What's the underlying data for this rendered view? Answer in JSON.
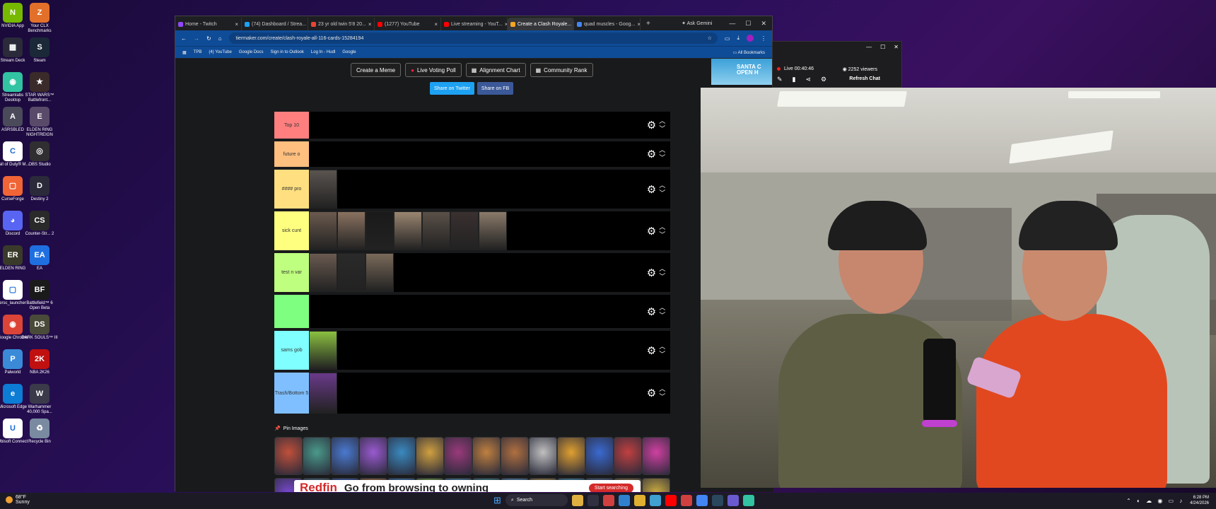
{
  "desktop": {
    "icons": [
      {
        "label": "NVIDIA App",
        "color": "#76b900",
        "glyph": "N"
      },
      {
        "label": "Your CLX Benchmarks",
        "color": "#e2702a",
        "glyph": "Z"
      },
      {
        "label": "Stream Deck",
        "color": "#2a2a3a",
        "glyph": "▦"
      },
      {
        "label": "Steam",
        "color": "#1b2838",
        "glyph": "S"
      },
      {
        "label": "Streamlabs Desktop",
        "color": "#31c3a2",
        "glyph": "◉"
      },
      {
        "label": "STAR WARS™ Battlefront...",
        "color": "#3a2a2a",
        "glyph": "★"
      },
      {
        "label": "ASRSBLED",
        "color": "#4a4a5a",
        "glyph": "A"
      },
      {
        "label": "ELDEN RING NIGHTREIGN",
        "color": "#5a4a6a",
        "glyph": "E"
      },
      {
        "label": "Call of Duty® M...",
        "color": "#ffffff",
        "glyph": "C"
      },
      {
        "label": "OBS Studio",
        "color": "#302e31",
        "glyph": "◎"
      },
      {
        "label": "CurseForge",
        "color": "#f16436",
        "glyph": "▢"
      },
      {
        "label": "Destiny 2",
        "color": "#2a2a3a",
        "glyph": "D"
      },
      {
        "label": "Discord",
        "color": "#5865f2",
        "glyph": "◕"
      },
      {
        "label": "Counter-Str... 2",
        "color": "#2a2a2a",
        "glyph": "CS"
      },
      {
        "label": "ELDEN RING",
        "color": "#3a3a2a",
        "glyph": "ER"
      },
      {
        "label": "EA",
        "color": "#1f6fe0",
        "glyph": "EA"
      },
      {
        "label": "ersc_launcher",
        "color": "#ffffff",
        "glyph": "▢"
      },
      {
        "label": "Battlefield™ 6 Open Beta",
        "color": "#1a1a1a",
        "glyph": "BF"
      },
      {
        "label": "Google Chrome",
        "color": "#db4437",
        "glyph": "◉"
      },
      {
        "label": "DARK SOULS™ III",
        "color": "#4a4a3a",
        "glyph": "DS"
      },
      {
        "label": "Palworld",
        "color": "#3a8ad8",
        "glyph": "P"
      },
      {
        "label": "NBA 2K26",
        "color": "#c01010",
        "glyph": "2K"
      },
      {
        "label": "Microsoft Edge",
        "color": "#0c7cd5",
        "glyph": "e"
      },
      {
        "label": "Warhammer 40,000 Spa...",
        "color": "#3a3a4a",
        "glyph": "W"
      },
      {
        "label": "Ubisoft Connect",
        "color": "#ffffff",
        "glyph": "U"
      },
      {
        "label": "Recycle Bin",
        "color": "#7a8aa0",
        "glyph": "♻"
      }
    ]
  },
  "browser": {
    "tabs": [
      {
        "label": "Home - Twitch",
        "color": "#9146ff"
      },
      {
        "label": "(74) Dashboard / Strea...",
        "color": "#1da1f2"
      },
      {
        "label": "23 yr old twin 5'8 20...",
        "color": "#ea4335"
      },
      {
        "label": "(1277) YouTube",
        "color": "#ff0000"
      },
      {
        "label": "Live streaming - YouT...",
        "color": "#ff0000"
      },
      {
        "label": "Create a Clash Royale...",
        "color": "#f5a623"
      },
      {
        "label": "quad muscles - Goog...",
        "color": "#4285f4"
      }
    ],
    "active_tab": 5,
    "new_tab": "+",
    "ask_gemini": "Ask Gemini",
    "url": "tiermaker.com/create/clash-royale-all-116-cards-15284194",
    "bookmarks": [
      "TPB",
      "(4) YouTube",
      "Google Docs",
      "Sign in to Outlook",
      "Log In - Hudl",
      "Google"
    ],
    "all_bookmarks": "All Bookmarks"
  },
  "page": {
    "buttons": [
      {
        "label": "Create a Meme",
        "icon": ""
      },
      {
        "label": "Live Voting Poll",
        "icon": "●"
      },
      {
        "label": "Alignment Chart",
        "icon": "▦"
      },
      {
        "label": "Community Rank",
        "icon": "▦"
      }
    ],
    "share_twitter": "Share on Twitter",
    "share_fb": "Share on FB",
    "ad_thumb": "SANTA C OPEN H",
    "tiers": [
      {
        "label": "Top 10",
        "color": "#ff7f7f",
        "items": []
      },
      {
        "label": "future o",
        "color": "#ffbf7f",
        "items": []
      },
      {
        "label": "#### pro",
        "color": "#ffdf7f",
        "items": [
          "#5a5450"
        ]
      },
      {
        "label": "sick cunt",
        "color": "#ffff7f",
        "items": [
          "#6b5a4e",
          "#8a7260",
          "#1a1a1a",
          "#9a8570",
          "#5a5048",
          "#3a3030",
          "#8a7a6a"
        ]
      },
      {
        "label": "test n var",
        "color": "#bfff7f",
        "items": [
          "#6a5a50",
          "#2a2a2a",
          "#7a6a5a"
        ]
      },
      {
        "label": "",
        "color": "#7fff7f",
        "items": []
      },
      {
        "label": "sams gob",
        "color": "#7fffff",
        "items": [
          "#8ac040"
        ]
      },
      {
        "label": "Trash/Bottom 5",
        "color": "#7fbfff",
        "items": [
          "#6a3a8a"
        ]
      }
    ],
    "pin_images": "Pin Images",
    "pool_row1": [
      "#c0503a",
      "#4a9a8a",
      "#4a7ad0",
      "#9a5ad0",
      "#3a8ac0",
      "#d0a040",
      "#9a3a7a",
      "#c08040",
      "#b07040",
      "#c0c0c0",
      "#e0a030",
      "#3a6ad0",
      "#c04040",
      "#d040a0"
    ],
    "pool_row2": [
      "#7a4ad0",
      "#4a7a8a",
      "#3a6ad0",
      "#c08040",
      "#3a8ad0",
      "#80c040",
      "#4a9ac0",
      "#3a9a9a",
      "#5aa0d0",
      "#c0a040",
      "#40a0c0",
      "#4a6a8a",
      "#9a7a3a",
      "#d0b040"
    ],
    "ad_brand": "Redfin",
    "ad_text": "Go from browsing to owning",
    "ad_button": "Start searching"
  },
  "chat": {
    "live": "Live 00:40:46",
    "viewers": "2252 viewers",
    "refresh": "Refresh Chat"
  },
  "taskbar": {
    "temp": "68°F",
    "weather": "Sunny",
    "search": "Search",
    "time": "6:28 PM",
    "date": "4/24/2026",
    "apps": [
      "#e0b040",
      "#303040",
      "#d04040",
      "#3080d0",
      "#e0b030",
      "#40a0d0",
      "#ff0000",
      "#d04040",
      "#4285f4",
      "#2a475e",
      "#6a5ad0",
      "#31c3a2"
    ]
  }
}
